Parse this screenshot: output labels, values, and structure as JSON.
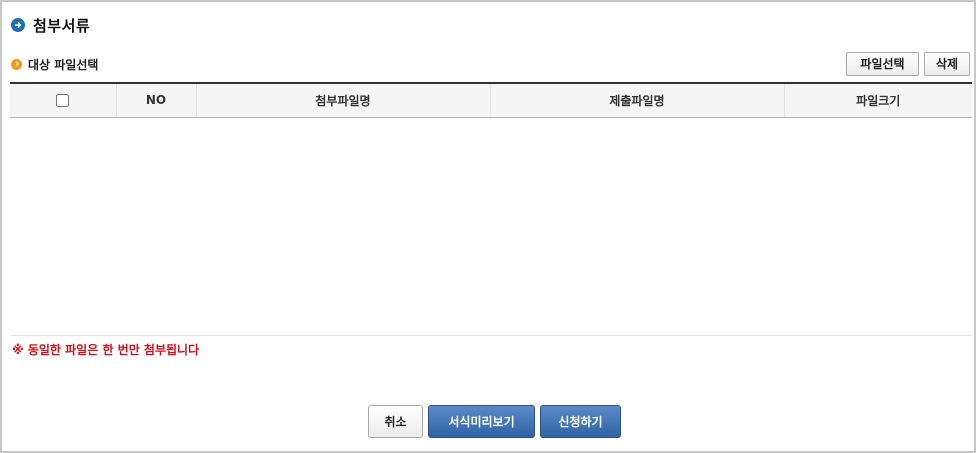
{
  "header": {
    "title": "첨부서류",
    "title_icon": "arrow-right-circle-icon"
  },
  "section": {
    "label": "대상 파일선택",
    "icon": "chevron-right-circle-icon"
  },
  "toolbar": {
    "select_file_label": "파일선택",
    "delete_label": "삭제"
  },
  "table": {
    "columns": [
      "NO",
      "첨부파일명",
      "제출파일명",
      "파일크기"
    ],
    "rows": []
  },
  "notice": "※ 동일한 파일은 한 번만 첨부됩니다",
  "actions": {
    "cancel_label": "취소",
    "preview_label": "서식미리보기",
    "apply_label": "신청하기"
  },
  "colors": {
    "accent_blue": "#2f63a6",
    "notice_red": "#d0101a",
    "section_orange": "#f39a1e"
  }
}
